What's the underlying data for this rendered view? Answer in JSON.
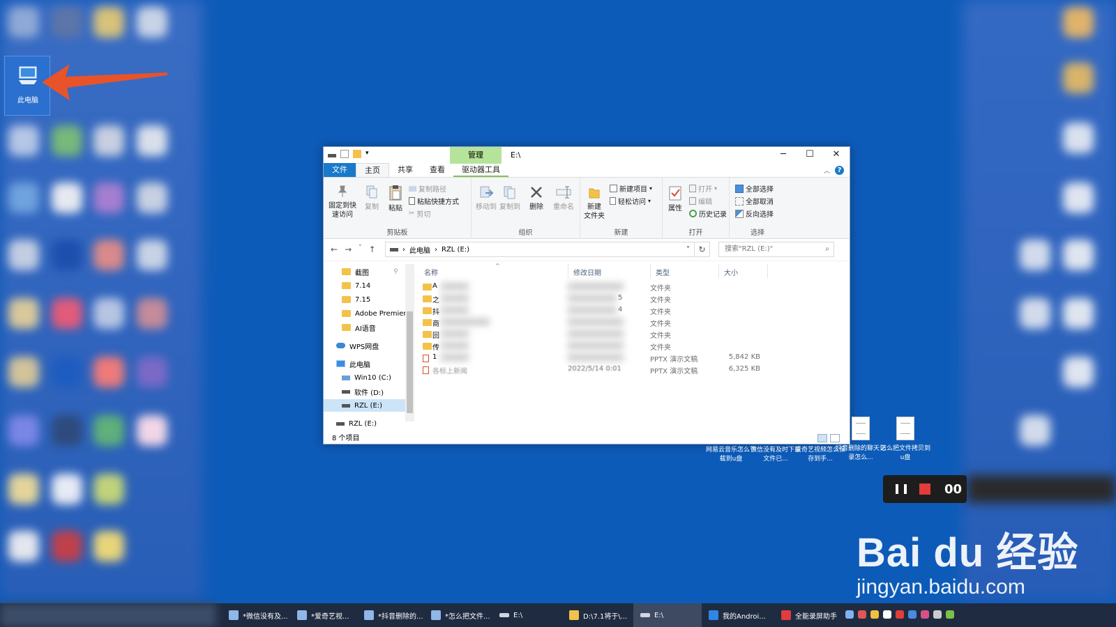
{
  "desktop": {
    "this_pc_label": "此电脑",
    "files": [
      {
        "label": "网易云音乐怎么下载到u盘"
      },
      {
        "label": "微信没有及时下载文件已..."
      },
      {
        "label": "爱奇艺视频怎么保存到手..."
      },
      {
        "label": "抖音删除的聊天记录怎么..."
      },
      {
        "label": "怎么把文件拷贝到u盘"
      }
    ]
  },
  "window": {
    "title": "E:\\",
    "manage_tab": "管理",
    "controls": {
      "minimize": "─",
      "maximize": "☐",
      "close": "✕"
    },
    "tabs": {
      "file": "文件",
      "home": "主页",
      "share": "共享",
      "view": "查看",
      "drive_tools": "驱动器工具"
    },
    "help": "?",
    "ribbon": {
      "pin": "固定到快速访问",
      "pin_l1": "固定到快",
      "pin_l2": "速访问",
      "copy": "复制",
      "paste": "粘贴",
      "copy_path": "复制路径",
      "paste_shortcut": "粘贴快捷方式",
      "cut": "剪切",
      "clipboard": "剪贴板",
      "move_to": "移动到",
      "copy_to": "复制到",
      "delete": "删除",
      "rename": "重命名",
      "organize": "组织",
      "new_folder_l1": "新建",
      "new_folder_l2": "文件夹",
      "new_item": "新建项目",
      "easy_access": "轻松访问",
      "new": "新建",
      "properties": "属性",
      "open": "打开",
      "edit": "编辑",
      "history": "历史记录",
      "open_group": "打开",
      "select_all": "全部选择",
      "select_none": "全部取消",
      "invert_selection": "反向选择",
      "select_group": "选择"
    },
    "address": {
      "crumb1": "此电脑",
      "crumb2": "RZL (E:)",
      "search_placeholder": "搜索\"RZL (E:)\""
    },
    "nav": [
      {
        "label": "截图"
      },
      {
        "label": "7.14"
      },
      {
        "label": "7.15"
      },
      {
        "label": "Adobe Premier"
      },
      {
        "label": "AI语音"
      },
      {
        "label": "WPS网盘"
      },
      {
        "label": "此电脑"
      },
      {
        "label": "Win10 (C:)"
      },
      {
        "label": "软件 (D:)"
      },
      {
        "label": "RZL (E:)"
      },
      {
        "label": "RZL (E:)"
      }
    ],
    "columns": {
      "name": "名称",
      "date": "修改日期",
      "type": "类型",
      "size": "大小"
    },
    "rows": [
      {
        "name": "A",
        "date": "",
        "type": "文件夹",
        "size": ""
      },
      {
        "name": "之",
        "date": "5",
        "type": "文件夹",
        "size": ""
      },
      {
        "name": "抖",
        "date": "4",
        "type": "文件夹",
        "size": ""
      },
      {
        "name": "商",
        "date": "",
        "type": "文件夹",
        "size": ""
      },
      {
        "name": "回",
        "date": "",
        "type": "文件夹",
        "size": ""
      },
      {
        "name": "传",
        "date": "",
        "type": "文件夹",
        "size": ""
      },
      {
        "name": "1",
        "date": "",
        "type": "PPTX 演示文稿",
        "size": "5,842 KB"
      },
      {
        "name": "各标上新闻",
        "date": "2022/5/14 0:01",
        "type": "PPTX 演示文稿",
        "size": "6,325 KB"
      }
    ],
    "status": "8 个项目"
  },
  "recorder": {
    "time": "00"
  },
  "taskbar": {
    "items": [
      {
        "label": "*微信没有及..."
      },
      {
        "label": "*爱奇艺视..."
      },
      {
        "label": "*抖音删除的..."
      },
      {
        "label": "*怎么把文件..."
      },
      {
        "label": "E:\\"
      },
      {
        "label": "D:\\7.1将于\\..."
      },
      {
        "label": "E:\\"
      },
      {
        "label": "我的Androi..."
      },
      {
        "label": "全能录屏助手"
      }
    ]
  },
  "watermark": {
    "brand": "Bai du 经验",
    "url": "jingyan.baidu.com"
  },
  "colors": {
    "desktop": "#0d5bb8",
    "accent": "#1979ca",
    "manage": "#b6e39a",
    "arrow": "#e8532a"
  }
}
